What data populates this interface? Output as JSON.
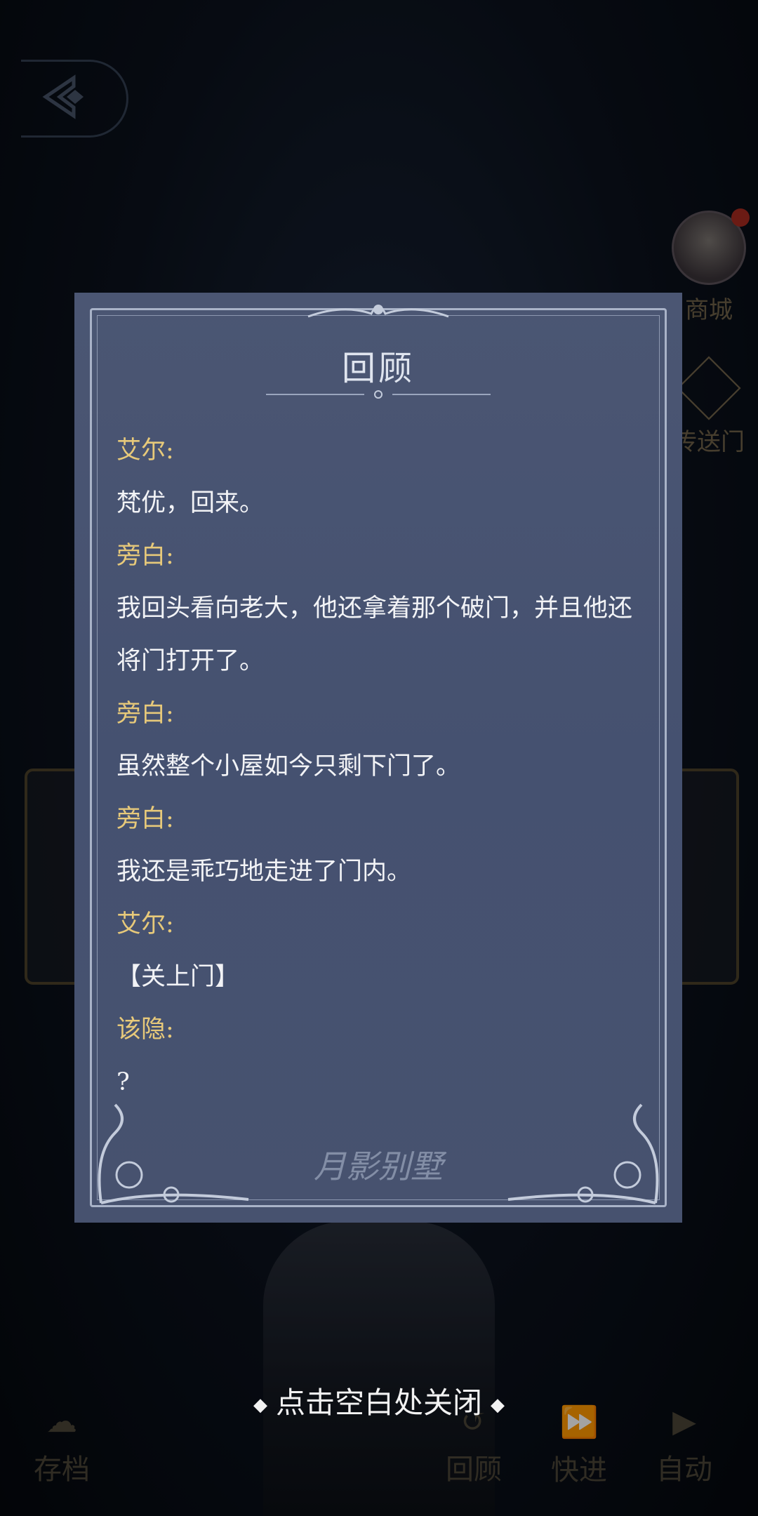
{
  "side_menu": {
    "shop_label": "商城",
    "portal_label": "传送门"
  },
  "bottom_bar": {
    "save_label": "存档",
    "review_label": "回顾",
    "fastforward_label": "快进",
    "auto_label": "自动"
  },
  "review_panel": {
    "title": "回顾",
    "entries": [
      {
        "speaker": "艾尔:",
        "text": "梵优，回来。"
      },
      {
        "speaker": "旁白:",
        "text": "我回头看向老大，他还拿着那个破门，并且他还将门打开了。"
      },
      {
        "speaker": "旁白:",
        "text": "虽然整个小屋如今只剩下门了。"
      },
      {
        "speaker": "旁白:",
        "text": "我还是乖巧地走进了门内。"
      },
      {
        "speaker": "艾尔:",
        "text": "【关上门】"
      },
      {
        "speaker": "该隐:",
        "text": "?"
      }
    ],
    "watermark": "月影别墅"
  },
  "close_hint": "点击空白处关闭",
  "colors": {
    "panel_bg": "#47526f",
    "speaker": "#e7c97a",
    "text": "#f2f3f6"
  }
}
